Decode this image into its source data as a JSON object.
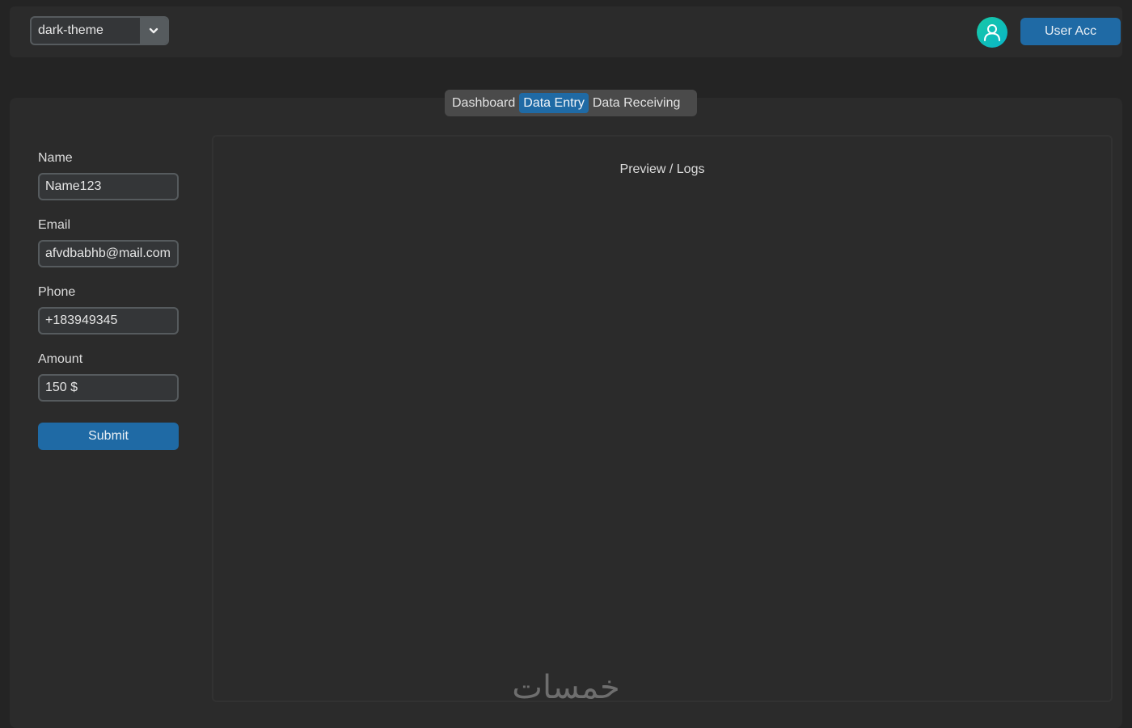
{
  "topbar": {
    "theme_select": {
      "value": "dark-theme",
      "icon": "chevron-down-icon"
    },
    "avatar": {
      "icon": "user-icon",
      "color": "#17c9a5"
    },
    "user_button_label": "User Acc"
  },
  "tabs": [
    {
      "label": "Dashboard",
      "active": false
    },
    {
      "label": "Data Entry",
      "active": true
    },
    {
      "label": "Data Receiving",
      "active": false
    }
  ],
  "form": {
    "fields": [
      {
        "label": "Name",
        "value": "Name123"
      },
      {
        "label": "Email",
        "value": "afvdbabhb@mail.com"
      },
      {
        "label": "Phone",
        "value": "+183949345"
      },
      {
        "label": "Amount",
        "value": "150 $"
      }
    ],
    "submit_label": "Submit"
  },
  "preview": {
    "title": "Preview / Logs"
  },
  "watermark": {
    "text": "خمسات"
  },
  "colors": {
    "accent": "#1f6aa5",
    "background": "#242424",
    "panel": "#2b2b2b"
  }
}
